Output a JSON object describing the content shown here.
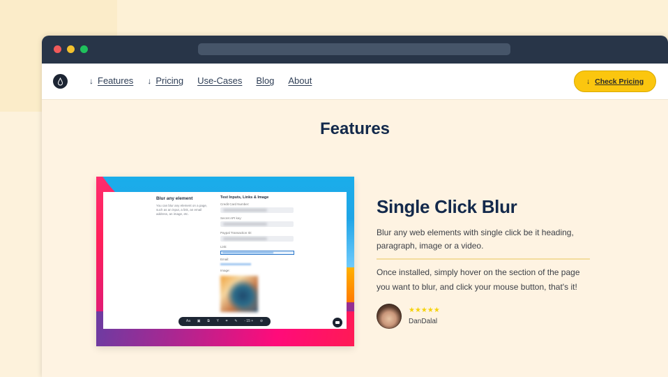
{
  "browser": {
    "window_controls": [
      "close",
      "minimize",
      "maximize"
    ],
    "url": ""
  },
  "nav": {
    "logo_icon": "droplet-icon",
    "links": [
      {
        "label": "Features",
        "icon": "arrow-down-icon"
      },
      {
        "label": "Pricing",
        "icon": "arrow-down-icon"
      },
      {
        "label": "Use-Cases",
        "icon": null
      },
      {
        "label": "Blog",
        "icon": null
      },
      {
        "label": "About",
        "icon": null
      }
    ],
    "cta": {
      "label": "Check Pricing",
      "icon": "arrow-down-icon",
      "color": "#fbc60f"
    }
  },
  "section": {
    "title": "Features"
  },
  "demo_screenshot": {
    "left_heading": "Blur any element",
    "left_text": "You can blur any element on a page, such as an input, a link, an email address, an image, etc.",
    "right_heading": "Test Inputs, Links & Image",
    "fields": [
      {
        "label": "Credit Card Number:"
      },
      {
        "label": "Secret API key:"
      },
      {
        "label": "Paypal Transaction ID:"
      },
      {
        "label": "Link:"
      },
      {
        "label": "Email:"
      },
      {
        "label": "Image:"
      }
    ],
    "toolbar_items": [
      "Aa",
      "▣",
      "⧉",
      "Y",
      "⌗",
      "✎",
      "- 15 +",
      "⊘"
    ]
  },
  "feature": {
    "title": "Single Click Blur",
    "description": "Blur any web elements with single click be it heading, paragraph, image or a video.",
    "details": "Once installed, simply hover on the section of the page you want to blur, and click your mouse button, that's it!",
    "review": {
      "rating": 5,
      "max_rating": 5,
      "stars": "★★★★★",
      "reviewer": "DanDalal"
    }
  }
}
